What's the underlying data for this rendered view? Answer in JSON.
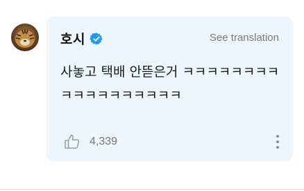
{
  "comment": {
    "author": "호시",
    "verified": true,
    "see_translation": "See translation",
    "text": "사놓고 택배 안뜯은거 ㅋㅋㅋㅋㅋㅋㅋㅋㅋㅋㅋㅋㅋㅋㅋㅋㅋㅋ",
    "likes": "4,339"
  },
  "icons": {
    "avatar": "tiger-avatar",
    "verified": "verified-check-icon",
    "like": "thumbs-up-icon",
    "more": "more-vertical-icon"
  },
  "colors": {
    "bubble_background": "#eef6fd",
    "verified_badge": "#1d9bf0",
    "muted_text": "#7a7a7a"
  }
}
